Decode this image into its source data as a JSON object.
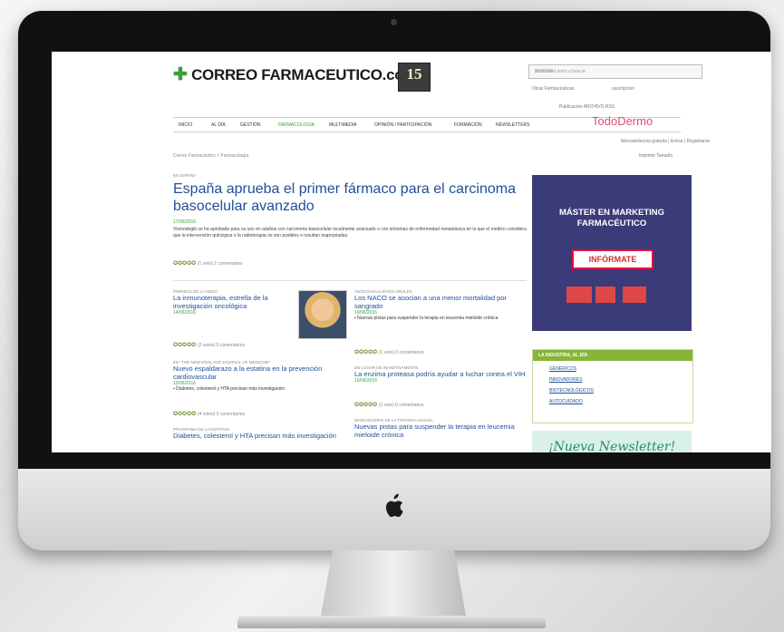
{
  "site": {
    "logo_text": "CORREO FARMACEUTICO.com",
    "logo_cross": "✚",
    "badge": "15",
    "search_placeholder": "Introduzca texto a buscar",
    "search_button": "BUSCAR",
    "small_links_1": "Otras Farmacéuticas",
    "small_links_2": "suscripcion",
    "newsletter_line": "Publicación   ARCHIVO   RSS",
    "nav": [
      "INICIO",
      "AL DÍA",
      "GESTIÓN",
      "FARMACOLOGÍA",
      "MULTIMEDIA",
      "OPINIÓN / PARTICIPACIÓN",
      "FORMACIÓN",
      "NEWSLETTERS"
    ],
    "nav_dermo": "TodoDermo",
    "breadcrumb": "Correo Farmacéutico > Farmacología",
    "login_text": "Mercadotecnia gratuita | Entrar | Registrarse",
    "tools_text": "Imprimir   Tamaño"
  },
  "lead": {
    "category": "EN ESPAÑA",
    "title": "España aprueba el primer fármaco para el carcinoma basocelular avanzado",
    "date": "17/06/2016",
    "text": "Vismodegib se ha aprobado para su uso en adultos con carcinoma basocelular localmente avanzado o con síntomas de enfermedad metastásica en la que el médico considera que la intervención quirúrgica o la radioterapia no son posibles o resultan inapropiadas.",
    "rating": "✪✪✪✪✪",
    "rating_meta": "(1 voto)   2 comentarios"
  },
  "stories_left": [
    {
      "category": "PREMIOS DE LA SEDO",
      "title": "La inmunoterapia, estrella de la investigación oncológica",
      "date": "14/06/2016",
      "rating": "✪✪✪✪✪",
      "meta": "(2 votos)  0 comentarios"
    },
    {
      "category": "EN \"THE NEW ENGLAND JOURNAL OF MEDICINE\"",
      "title": "Nuevo espaldarazo a la estatina en la prevención cardiovascular",
      "date": "13/06/2016",
      "bullet": "▪ Diabetes, colesterol y HTA precisan más investigación",
      "rating": "✪✪✪✪✪",
      "meta": "(4 votos)  0 comentarios"
    },
    {
      "category": "PROGRAMA DE LA ESTATINA",
      "title": "Diabetes, colesterol y HTA precisan más investigación"
    }
  ],
  "stories_right": [
    {
      "category": "ANTICOAGULANTES ORALES",
      "title": "Los NACO se asocian a una menor mortalidad por sangrado",
      "date": "10/06/2016",
      "bullet": "▪ Nuevas pistas para suspender la terapia en leucemia mieloide crónica",
      "rating": "✪✪✪✪✪",
      "meta": "(1 voto)  0 comentarios"
    },
    {
      "category": "EN LUGAR DE INHIBITIVAMENTE",
      "title": "La enzima proteasa podría ayudar a luchar contra el VIH",
      "date": "10/06/2016",
      "rating": "✪✪✪✪✪",
      "meta": "(1 voto)  0 comentarios"
    },
    {
      "category": "MARCADORES DE LA TIROSINA-KINASA",
      "title": "Nuevas pistas para suspender la terapia en leucemia mieloide crónica"
    }
  ],
  "ad": {
    "title": "MÁSTER EN MARKETING FARMACÉUTICO",
    "button": "INFÓRMATE"
  },
  "panel": {
    "title": "LA INDUSTRIA, AL DÍA",
    "links": [
      "GENÉRICOS",
      "INNOVADORES",
      "BIOTECNOLÓGICOS",
      "AUTOCUIDADO"
    ]
  },
  "promo_text": "¡Nueva Newsletter!"
}
